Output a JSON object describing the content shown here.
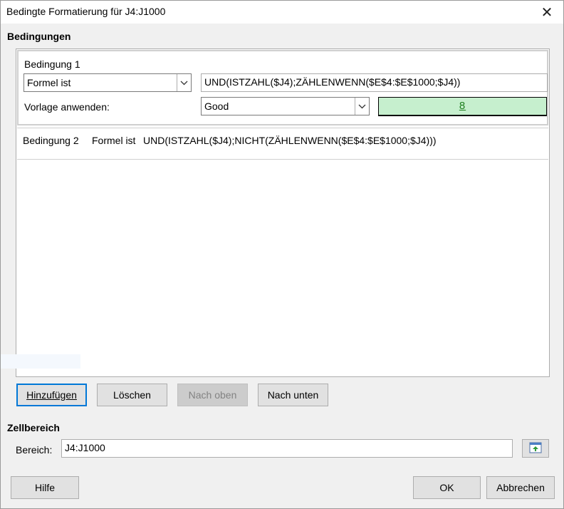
{
  "window": {
    "title": "Bedingte Formatierung für J4:J1000",
    "close_glyph": "✕"
  },
  "conditions_section": {
    "title": "Bedingungen"
  },
  "condition1": {
    "title": "Bedingung 1",
    "type": "Formel ist",
    "formula": "UND(ISTZAHL($J4);ZÄHLENWENN($E$4:$E$1000;$J4))",
    "style_label": "Vorlage anwenden:",
    "style_value": "Good",
    "preview_text": "8"
  },
  "condition2": {
    "title": "Bedingung 2",
    "type": "Formel ist",
    "formula": "UND(ISTZAHL($J4);NICHT(ZÄHLENWENN($E$4:$E$1000;$J4)))"
  },
  "condition_buttons": {
    "add_label": "Hinzufügen",
    "delete_label": "Löschen",
    "up_label": "Nach oben",
    "down_label": "Nach unten"
  },
  "range_section": {
    "title": "Zellbereich",
    "range_label": "Bereich:",
    "range_value": "J4:J1000"
  },
  "footer": {
    "help_label": "Hilfe",
    "ok_label": "OK",
    "cancel_label": "Abbrechen"
  },
  "colors": {
    "accent": "#0078d7",
    "preview_bg": "#c6efce",
    "preview_fg": "#1f7f1f"
  },
  "icons": {
    "dropdown": "chevron-down-icon",
    "shrink": "shrink-dialog-icon",
    "close": "close-icon"
  }
}
